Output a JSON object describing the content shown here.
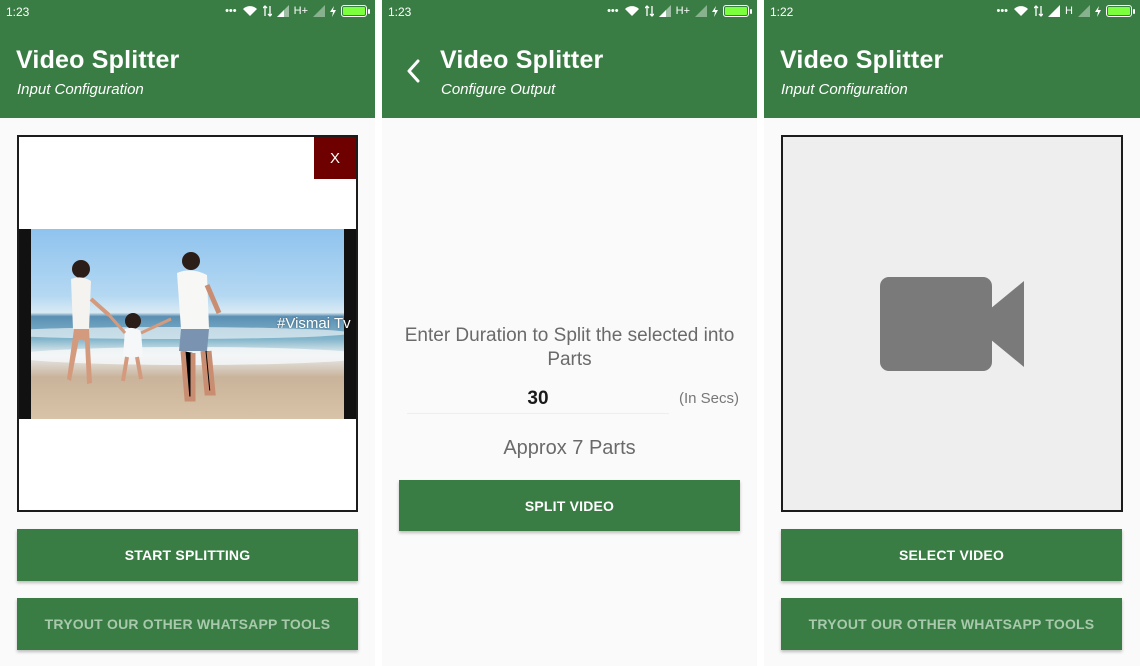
{
  "screens": [
    {
      "status": {
        "time": "1:23",
        "network": "H+"
      },
      "appbar": {
        "title": "Video Splitter",
        "subtitle": "Input Configuration"
      },
      "preview": {
        "close_label": "X",
        "watermark": "#Vismai Tv"
      },
      "buttons": {
        "primary": "START SPLITTING",
        "secondary": "TRYOUT OUR OTHER WHATSAPP TOOLS"
      }
    },
    {
      "status": {
        "time": "1:23",
        "network": "H+"
      },
      "appbar": {
        "title": "Video Splitter",
        "subtitle": "Configure Output"
      },
      "prompt": "Enter Duration to Split the selected into Parts",
      "duration": {
        "value": "30",
        "unit": "(In Secs)"
      },
      "approx": "Approx 7 Parts",
      "buttons": {
        "split": "SPLIT VIDEO"
      }
    },
    {
      "status": {
        "time": "1:22",
        "network": "H"
      },
      "appbar": {
        "title": "Video Splitter",
        "subtitle": "Input Configuration"
      },
      "buttons": {
        "primary": "SELECT VIDEO",
        "secondary": "TRYOUT OUR OTHER WHATSAPP TOOLS"
      }
    }
  ],
  "colors": {
    "primary": "#3a7d44",
    "close": "#6e0000",
    "muted_text": "#a9c9ad",
    "placeholder_bg": "#eeeeee",
    "camera_icon": "#7a7a7a"
  },
  "icons": {
    "status": [
      "more-dots-icon",
      "wifi-icon",
      "data-arrows-icon",
      "signal-icon",
      "no-signal-icon",
      "charging-icon",
      "battery-icon"
    ],
    "back": "back-arrow-icon",
    "placeholder": "video-camera-icon"
  }
}
